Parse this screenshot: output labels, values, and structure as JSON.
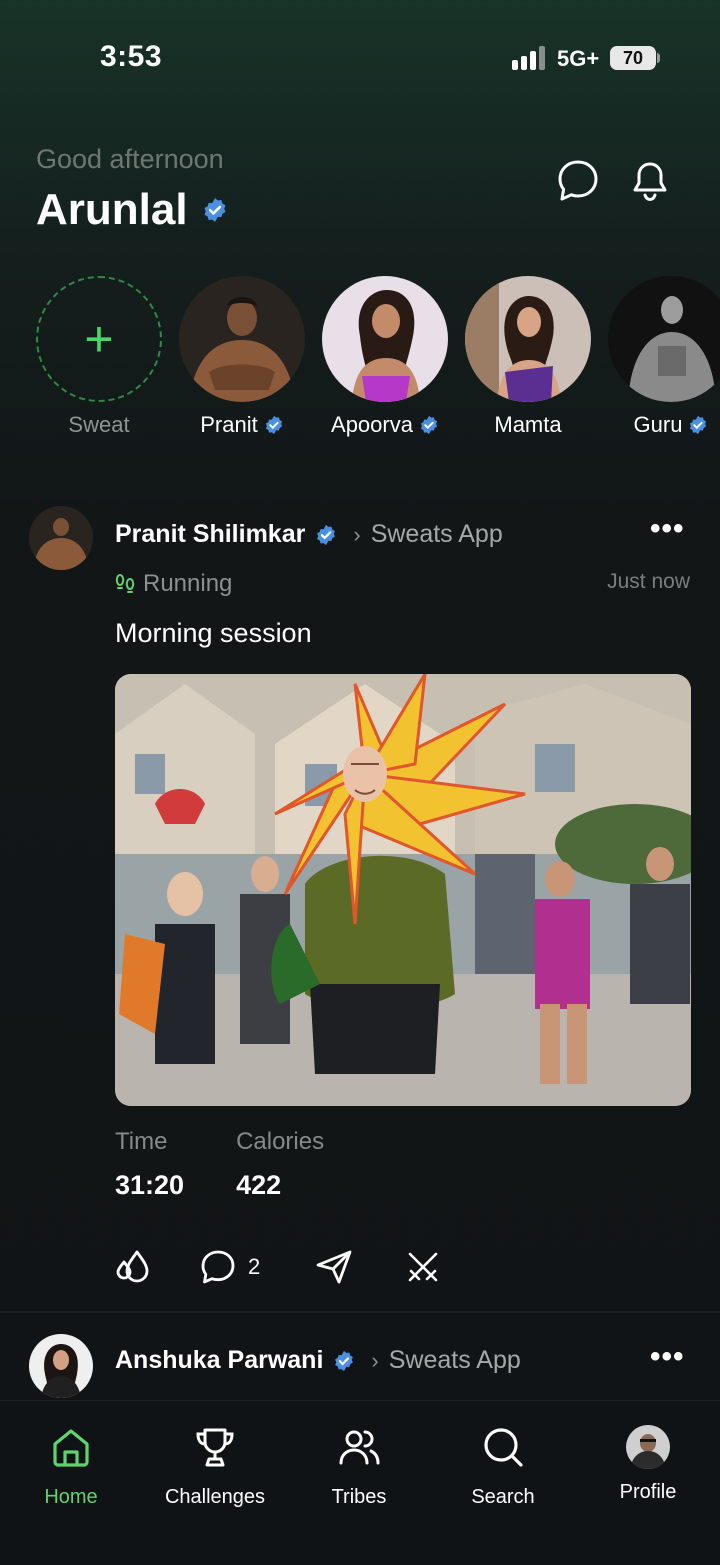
{
  "status_bar": {
    "time": "3:53",
    "network": "5G+",
    "battery": "70"
  },
  "header": {
    "greeting": "Good afternoon",
    "user_name": "Arunlal",
    "icons": [
      "chat-bubble-icon",
      "bell-icon"
    ]
  },
  "stories": [
    {
      "label": "Sweat",
      "verified": false,
      "kind": "add"
    },
    {
      "label": "Pranit",
      "verified": true
    },
    {
      "label": "Apoorva",
      "verified": true
    },
    {
      "label": "Mamta",
      "verified": false
    },
    {
      "label": "Guru",
      "verified": true
    }
  ],
  "posts": [
    {
      "author": "Pranit Shilimkar",
      "verified": true,
      "community": "Sweats App",
      "activity": "Running",
      "time": "Just now",
      "caption": "Morning session",
      "stats": [
        {
          "label": "Time",
          "value": "31:20"
        },
        {
          "label": "Calories",
          "value": "422"
        }
      ],
      "comment_count": "2"
    },
    {
      "author": "Anshuka Parwani",
      "verified": true,
      "community": "Sweats App"
    }
  ],
  "tabbar": {
    "items": [
      {
        "label": "Home",
        "icon": "home-icon",
        "active": true
      },
      {
        "label": "Challenges",
        "icon": "trophy-icon"
      },
      {
        "label": "Tribes",
        "icon": "people-icon"
      },
      {
        "label": "Search",
        "icon": "search-icon"
      },
      {
        "label": "Profile",
        "icon": "avatar"
      }
    ]
  },
  "colors": {
    "accent": "#5ed36f",
    "verified": "#4a90e2",
    "background": "#111416"
  }
}
